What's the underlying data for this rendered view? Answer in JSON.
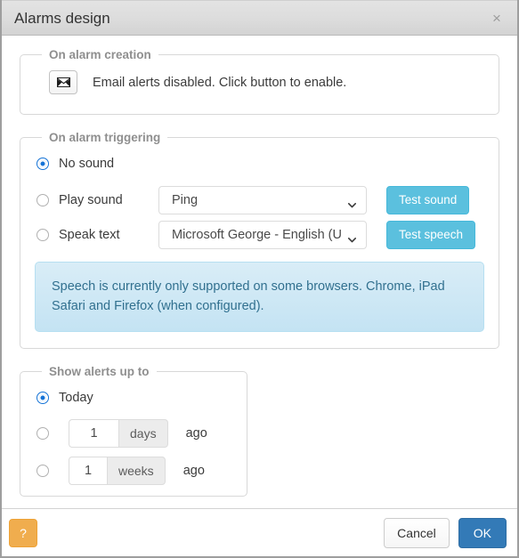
{
  "dialog": {
    "title": "Alarms design",
    "close_label": "×"
  },
  "alarm_creation": {
    "legend": "On alarm creation",
    "email_status_text": "Email alerts disabled. Click button to enable."
  },
  "alarm_triggering": {
    "legend": "On alarm triggering",
    "options": [
      {
        "label": "No sound",
        "selected": true
      },
      {
        "label": "Play sound",
        "selected": false
      },
      {
        "label": "Speak text",
        "selected": false
      }
    ],
    "sound_select_value": "Ping",
    "test_sound_label": "Test sound",
    "speech_select_value": "Microsoft George - English (U",
    "test_speech_label": "Test speech",
    "notice": "Speech is currently only supported on some browsers. Chrome, iPad Safari and Firefox (when configured)."
  },
  "show_alerts": {
    "legend": "Show alerts up to",
    "today_label": "Today",
    "rows": [
      {
        "value": "1",
        "unit": "days",
        "suffix": "ago",
        "selected": false
      },
      {
        "value": "1",
        "unit": "weeks",
        "suffix": "ago",
        "selected": false
      }
    ]
  },
  "footer": {
    "help_label": "?",
    "cancel_label": "Cancel",
    "ok_label": "OK"
  },
  "colors": {
    "titlebar": "#dcdcdc",
    "radio_selected": "#1372d6",
    "info_button": "#5bc0de",
    "alert_background": "#d9edf7",
    "alert_text": "#31708f",
    "help_button": "#f0ad4e",
    "primary_button": "#337ab7"
  }
}
